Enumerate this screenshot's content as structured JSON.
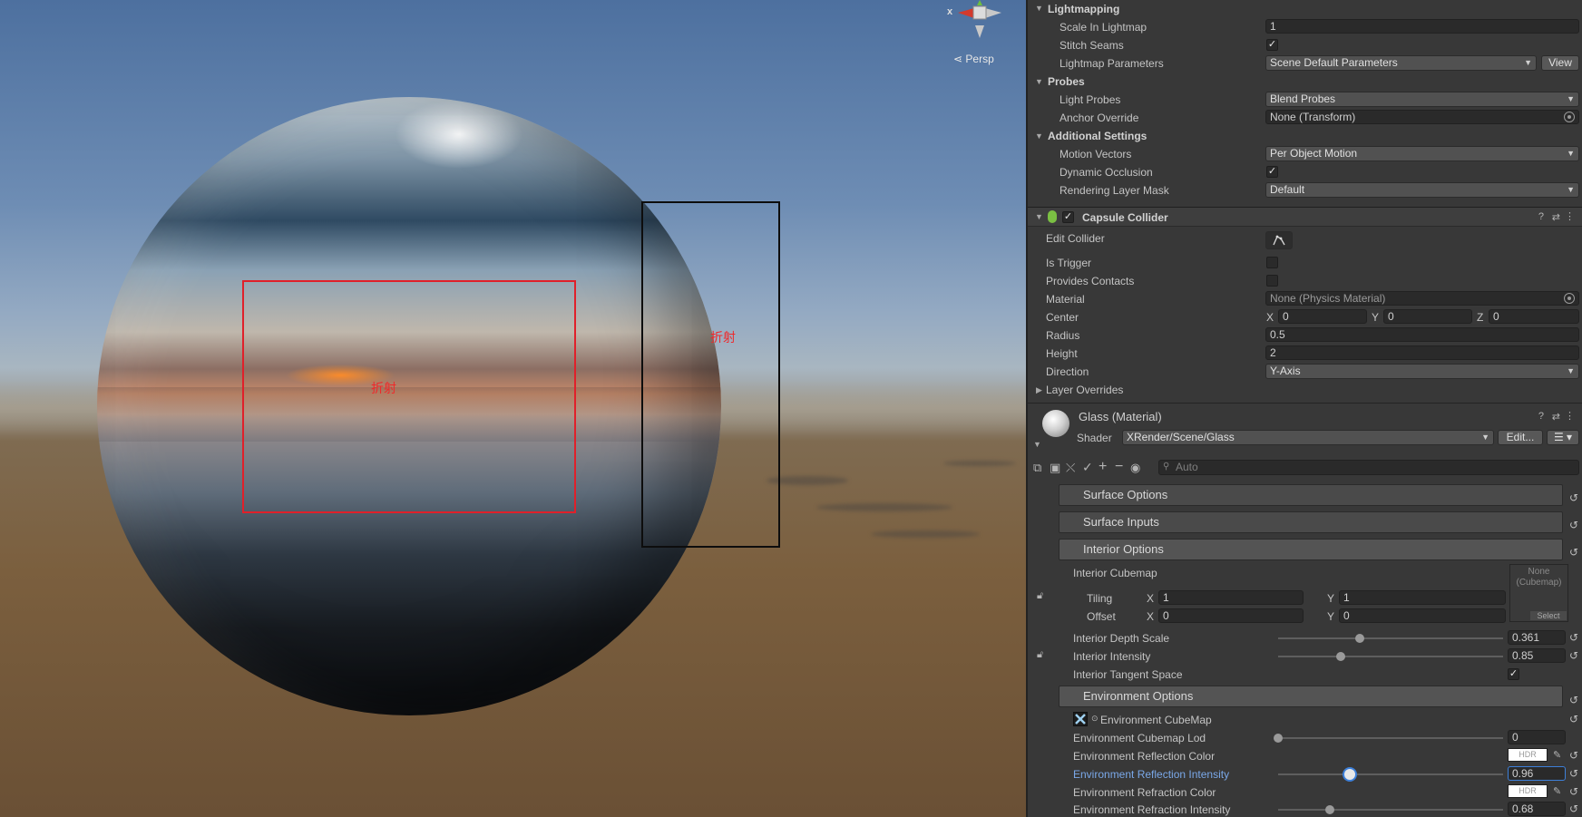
{
  "scene": {
    "annotation_red": "折射",
    "annotation_black": "折射",
    "gizmo_axis": "x",
    "view_mode": "Persp"
  },
  "lightmapping": {
    "header": "Lightmapping",
    "scale_label": "Scale In Lightmap",
    "scale_value": "1",
    "stitch_label": "Stitch Seams",
    "params_label": "Lightmap Parameters",
    "params_value": "Scene Default Parameters",
    "view_button": "View"
  },
  "probes": {
    "header": "Probes",
    "light_label": "Light Probes",
    "light_value": "Blend Probes",
    "anchor_label": "Anchor Override",
    "anchor_value": "None (Transform)"
  },
  "additional": {
    "header": "Additional Settings",
    "motion_label": "Motion Vectors",
    "motion_value": "Per Object Motion",
    "occlusion_label": "Dynamic Occlusion",
    "layer_label": "Rendering Layer Mask",
    "layer_value": "Default"
  },
  "capsule": {
    "title": "Capsule Collider",
    "edit_label": "Edit Collider",
    "trigger_label": "Is Trigger",
    "contacts_label": "Provides Contacts",
    "material_label": "Material",
    "material_value": "None (Physics Material)",
    "center_label": "Center",
    "center_x": "0",
    "center_y": "0",
    "center_z": "0",
    "radius_label": "Radius",
    "radius_value": "0.5",
    "height_label": "Height",
    "height_value": "2",
    "direction_label": "Direction",
    "direction_value": "Y-Axis",
    "overrides_label": "Layer Overrides"
  },
  "material": {
    "name": "Glass (Material)",
    "shader_label": "Shader",
    "shader_value": "XRender/Scene/Glass",
    "edit_button": "Edit...",
    "search_placeholder": "Auto"
  },
  "sections": {
    "surface_options": "Surface Options",
    "surface_inputs": "Surface Inputs",
    "interior_options": "Interior Options",
    "environment_options": "Environment Options"
  },
  "interior": {
    "cubemap_label": "Interior Cubemap",
    "cubemap_slot": "None (Cubemap)",
    "select_label": "Select",
    "tiling_label": "Tiling",
    "tiling_x": "1",
    "tiling_y": "1",
    "offset_label": "Offset",
    "offset_x": "0",
    "offset_y": "0",
    "depth_label": "Interior Depth Scale",
    "depth_value": "0.361",
    "depth_fraction": 0.361,
    "intensity_label": "Interior Intensity",
    "intensity_value": "0.85",
    "intensity_fraction": 0.28,
    "tangent_label": "Interior Tangent Space"
  },
  "environment": {
    "cubemap_label": "Environment CubeMap",
    "lod_label": "Environment Cubemap Lod",
    "lod_value": "0",
    "lod_fraction": 0.0,
    "refl_color_label": "Environment Reflection Color",
    "hdr": "HDR",
    "refl_int_label": "Environment Reflection Intensity",
    "refl_int_value": "0.96",
    "refl_fraction": 0.32,
    "refr_color_label": "Environment Refraction Color",
    "refr_int_label": "Environment Refraction Intensity",
    "refr_int_value": "0.68",
    "refr_fraction": 0.23
  }
}
